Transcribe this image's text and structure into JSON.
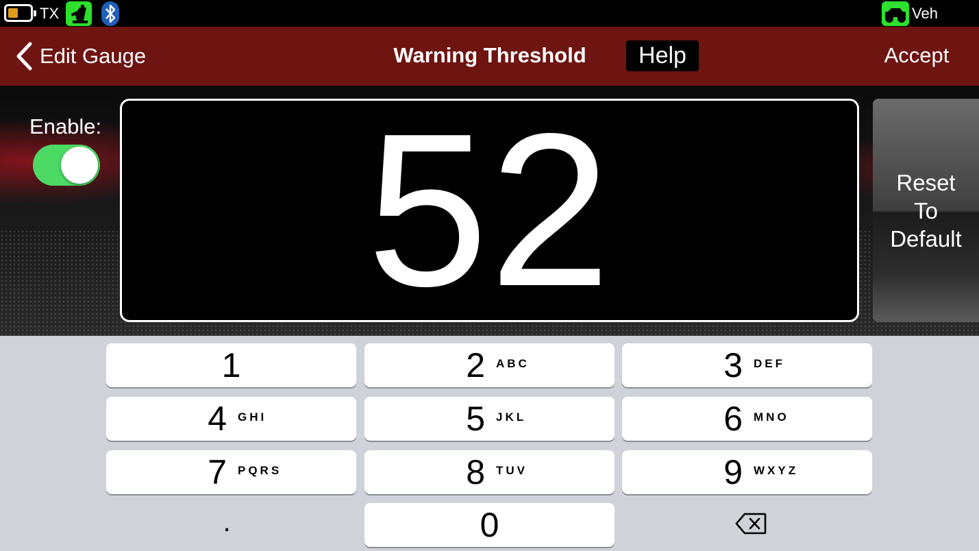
{
  "status_bar": {
    "tx_label": "TX",
    "veh_label": "Veh",
    "battery_icon": "battery-icon",
    "radio_icon": "radio-transmitter-icon",
    "bluetooth_icon": "bluetooth-icon",
    "vehicle_icon": "vehicle-icon",
    "accent_green": "#2de02d",
    "bluetooth_blue": "#1f5fb8"
  },
  "nav": {
    "back_label": "Edit Gauge",
    "title": "Warning Threshold",
    "help_label": "Help",
    "accept_label": "Accept",
    "bar_color": "#6e1411"
  },
  "settings": {
    "enable_label": "Enable:",
    "enabled": true,
    "value": "52",
    "reset_lines": [
      "Reset",
      "To",
      "Default"
    ]
  },
  "keypad": {
    "keys": [
      {
        "digit": "1",
        "letters": ""
      },
      {
        "digit": "2",
        "letters": "ABC"
      },
      {
        "digit": "3",
        "letters": "DEF"
      },
      {
        "digit": "4",
        "letters": "GHI"
      },
      {
        "digit": "5",
        "letters": "JKL"
      },
      {
        "digit": "6",
        "letters": "MNO"
      },
      {
        "digit": "7",
        "letters": "PQRS"
      },
      {
        "digit": "8",
        "letters": "TUV"
      },
      {
        "digit": "9",
        "letters": "WXYZ"
      },
      {
        "digit": "0",
        "letters": ""
      }
    ],
    "decimal_label": ".",
    "delete_icon": "backspace-icon"
  }
}
